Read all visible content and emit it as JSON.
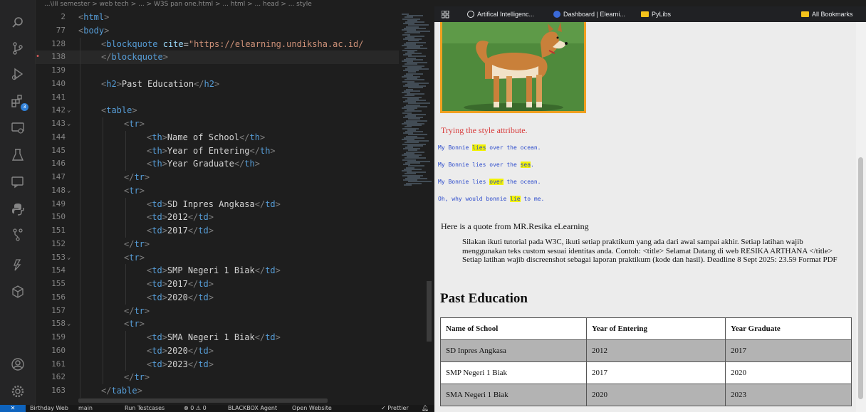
{
  "editor": {
    "breadcrumb": "...\\III semester > web tech > ... > W3S pan one.html > ... html > ... head > ... style",
    "lines": [
      {
        "num": "2",
        "fold": "",
        "indent": 0,
        "html": "<span class='bracket'>&lt;</span><span class='tag'>html</span><span class='bracket'>&gt;</span>"
      },
      {
        "num": "77",
        "fold": "",
        "indent": 0,
        "html": "<span class='bracket'>&lt;</span><span class='tag'>body</span><span class='bracket'>&gt;</span>"
      },
      {
        "num": "128",
        "fold": "",
        "indent": 1,
        "html": "<span class='bracket'>&lt;</span><span class='tag'>blockquote</span> <span class='attr'>cite</span><span class='txt'>=</span><span class='str'>\"https://elearning.undiksha.ac.id/</span>"
      },
      {
        "num": "138",
        "fold": "",
        "indent": 1,
        "bp": true,
        "html": "<span class='bracket'>&lt;/</span><span class='tag'>blockquote</span><span class='bracket'>&gt;</span>"
      },
      {
        "num": "139",
        "fold": "",
        "indent": 1,
        "html": ""
      },
      {
        "num": "140",
        "fold": "",
        "indent": 1,
        "html": "<span class='bracket'>&lt;</span><span class='tag'>h2</span><span class='bracket'>&gt;</span><span class='txt'>Past Education</span><span class='bracket'>&lt;/</span><span class='tag'>h2</span><span class='bracket'>&gt;</span>"
      },
      {
        "num": "141",
        "fold": "",
        "indent": 1,
        "html": ""
      },
      {
        "num": "142",
        "fold": "v",
        "indent": 1,
        "html": "<span class='bracket'>&lt;</span><span class='tag'>table</span><span class='bracket'>&gt;</span>"
      },
      {
        "num": "143",
        "fold": "v",
        "indent": 2,
        "html": "<span class='bracket'>&lt;</span><span class='tag'>tr</span><span class='bracket'>&gt;</span>"
      },
      {
        "num": "144",
        "fold": "",
        "indent": 3,
        "html": "<span class='bracket'>&lt;</span><span class='tag'>th</span><span class='bracket'>&gt;</span><span class='txt'>Name of School</span><span class='bracket'>&lt;/</span><span class='tag'>th</span><span class='bracket'>&gt;</span>"
      },
      {
        "num": "145",
        "fold": "",
        "indent": 3,
        "html": "<span class='bracket'>&lt;</span><span class='tag'>th</span><span class='bracket'>&gt;</span><span class='txt'>Year of Entering</span><span class='bracket'>&lt;/</span><span class='tag'>th</span><span class='bracket'>&gt;</span>"
      },
      {
        "num": "146",
        "fold": "",
        "indent": 3,
        "html": "<span class='bracket'>&lt;</span><span class='tag'>th</span><span class='bracket'>&gt;</span><span class='txt'>Year Graduate</span><span class='bracket'>&lt;/</span><span class='tag'>th</span><span class='bracket'>&gt;</span>"
      },
      {
        "num": "147",
        "fold": "",
        "indent": 2,
        "html": "<span class='bracket'>&lt;/</span><span class='tag'>tr</span><span class='bracket'>&gt;</span>"
      },
      {
        "num": "148",
        "fold": "v",
        "indent": 2,
        "html": "<span class='bracket'>&lt;</span><span class='tag'>tr</span><span class='bracket'>&gt;</span>"
      },
      {
        "num": "149",
        "fold": "",
        "indent": 3,
        "html": "<span class='bracket'>&lt;</span><span class='tag'>td</span><span class='bracket'>&gt;</span><span class='txt'>SD Inpres Angkasa</span><span class='bracket'>&lt;/</span><span class='tag'>td</span><span class='bracket'>&gt;</span>"
      },
      {
        "num": "150",
        "fold": "",
        "indent": 3,
        "html": "<span class='bracket'>&lt;</span><span class='tag'>td</span><span class='bracket'>&gt;</span><span class='txt'>2012</span><span class='bracket'>&lt;/</span><span class='tag'>td</span><span class='bracket'>&gt;</span>"
      },
      {
        "num": "151",
        "fold": "",
        "indent": 3,
        "html": "<span class='bracket'>&lt;</span><span class='tag'>td</span><span class='bracket'>&gt;</span><span class='txt'>2017</span><span class='bracket'>&lt;/</span><span class='tag'>td</span><span class='bracket'>&gt;</span>"
      },
      {
        "num": "152",
        "fold": "",
        "indent": 2,
        "html": "<span class='bracket'>&lt;/</span><span class='tag'>tr</span><span class='bracket'>&gt;</span>"
      },
      {
        "num": "153",
        "fold": "v",
        "indent": 2,
        "html": "<span class='bracket'>&lt;</span><span class='tag'>tr</span><span class='bracket'>&gt;</span>"
      },
      {
        "num": "154",
        "fold": "",
        "indent": 3,
        "html": "<span class='bracket'>&lt;</span><span class='tag'>td</span><span class='bracket'>&gt;</span><span class='txt'>SMP Negeri 1 Biak</span><span class='bracket'>&lt;/</span><span class='tag'>td</span><span class='bracket'>&gt;</span>"
      },
      {
        "num": "155",
        "fold": "",
        "indent": 3,
        "html": "<span class='bracket'>&lt;</span><span class='tag'>td</span><span class='bracket'>&gt;</span><span class='txt'>2017</span><span class='bracket'>&lt;/</span><span class='tag'>td</span><span class='bracket'>&gt;</span>"
      },
      {
        "num": "156",
        "fold": "",
        "indent": 3,
        "html": "<span class='bracket'>&lt;</span><span class='tag'>td</span><span class='bracket'>&gt;</span><span class='txt'>2020</span><span class='bracket'>&lt;/</span><span class='tag'>td</span><span class='bracket'>&gt;</span>"
      },
      {
        "num": "157",
        "fold": "",
        "indent": 2,
        "html": "<span class='bracket'>&lt;/</span><span class='tag'>tr</span><span class='bracket'>&gt;</span>"
      },
      {
        "num": "158",
        "fold": "v",
        "indent": 2,
        "html": "<span class='bracket'>&lt;</span><span class='tag'>tr</span><span class='bracket'>&gt;</span>"
      },
      {
        "num": "159",
        "fold": "",
        "indent": 3,
        "html": "<span class='bracket'>&lt;</span><span class='tag'>td</span><span class='bracket'>&gt;</span><span class='txt'>SMA Negeri 1 Biak</span><span class='bracket'>&lt;/</span><span class='tag'>td</span><span class='bracket'>&gt;</span>"
      },
      {
        "num": "160",
        "fold": "",
        "indent": 3,
        "html": "<span class='bracket'>&lt;</span><span class='tag'>td</span><span class='bracket'>&gt;</span><span class='txt'>2020</span><span class='bracket'>&lt;/</span><span class='tag'>td</span><span class='bracket'>&gt;</span>"
      },
      {
        "num": "161",
        "fold": "",
        "indent": 3,
        "html": "<span class='bracket'>&lt;</span><span class='tag'>td</span><span class='bracket'>&gt;</span><span class='txt'>2023</span><span class='bracket'>&lt;/</span><span class='tag'>td</span><span class='bracket'>&gt;</span>"
      },
      {
        "num": "162",
        "fold": "",
        "indent": 2,
        "html": "<span class='bracket'>&lt;/</span><span class='tag'>tr</span><span class='bracket'>&gt;</span>"
      },
      {
        "num": "163",
        "fold": "",
        "indent": 1,
        "html": "<span class='bracket'>&lt;/</span><span class='tag'>table</span><span class='bracket'>&gt;</span>"
      }
    ]
  },
  "status_bar": {
    "remote": "✕",
    "items": [
      {
        "label": "Birthday Web"
      },
      {
        "label": "main"
      },
      {
        "label": "Run Testcases"
      },
      {
        "label": "⊗ 0 ⚠ 0"
      },
      {
        "label": "BLACKBOX Agent"
      },
      {
        "label": "Open Website"
      },
      {
        "label": "✓ Prettier"
      }
    ]
  },
  "browser": {
    "bookmarks": [
      {
        "label": "Artifical Intelligenc...",
        "icon": "openai-icon",
        "color": "#ffffff"
      },
      {
        "label": "Dashboard | Elearni...",
        "icon": "elearning-icon",
        "color": "#3b6ad8"
      },
      {
        "label": "PyLibs",
        "icon": "folder-icon",
        "color": "#f4c21b"
      }
    ],
    "all_bookmarks": "All Bookmarks",
    "page": {
      "style_text": "Trying the style attribute.",
      "mono_lines": [
        {
          "before": "My Bonnie ",
          "hl": "lies",
          "after": " over the ocean."
        },
        {
          "before": "My Bonnie lies over the ",
          "hl": "sea",
          "after": "."
        },
        {
          "before": "My Bonnie lies ",
          "hl": "over",
          "after": " the ocean."
        },
        {
          "before": "Oh, why would bonnie ",
          "hl": "lie",
          "after": " to me."
        }
      ],
      "quote_intro": "Here is a quote from MR.Resika eLearning",
      "quote_body": "Silakan ikuti tutorial pada W3C, ikuti setiap praktikum yang ada dari awal sampai akhir. Setiap latihan wajib menggunakan teks custom sesuai identitas anda. Contoh: <title> Selamat Datang di web RESIKA ARTHANA </title> Setiap latihan wajib discreenshot sebagai laporan praktikum (kode dan hasil). Deadline 8 Sept 2025: 23.59 Format PDF",
      "heading": "Past Education",
      "table": {
        "headers": [
          "Name of School",
          "Year of Entering",
          "Year Graduate"
        ],
        "rows": [
          [
            "SD Inpres Angkasa",
            "2012",
            "2017"
          ],
          [
            "SMP Negeri 1 Biak",
            "2017",
            "2020"
          ],
          [
            "SMA Negeri 1 Biak",
            "2020",
            "2023"
          ]
        ]
      }
    }
  },
  "colors": {
    "editor_bg": "#1e1e1e",
    "tag": "#569cd6",
    "attr": "#9cdcfe",
    "string": "#ce9178",
    "highlight": "#f2f200",
    "style_text": "#d83a3a",
    "dog_frame": "#f0a020"
  }
}
